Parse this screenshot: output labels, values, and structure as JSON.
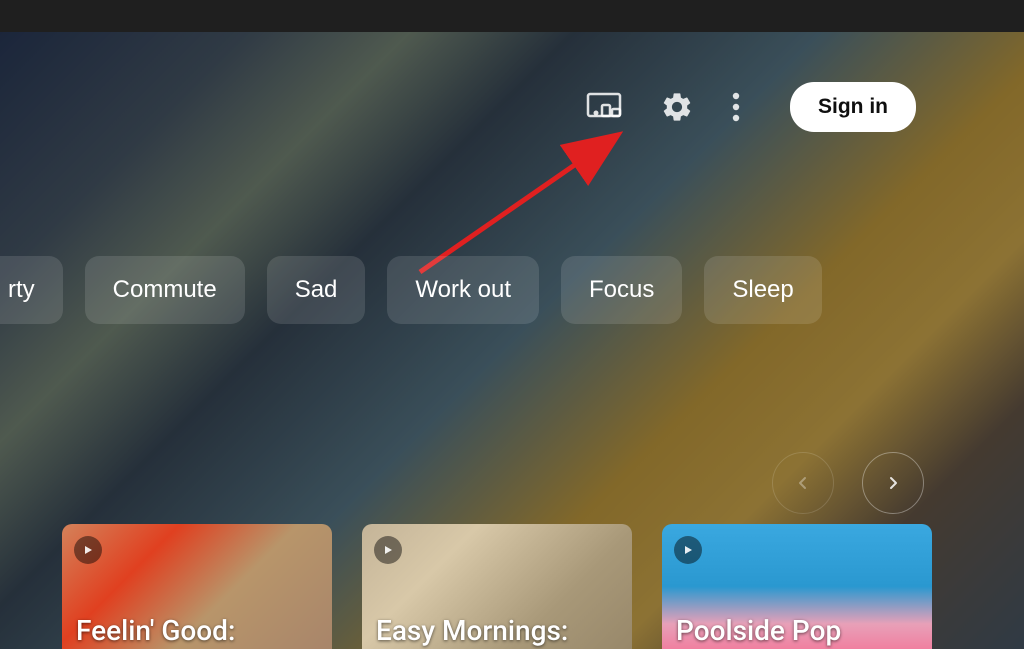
{
  "header": {
    "sign_in_label": "Sign in"
  },
  "chips": {
    "partial": "rty",
    "items": [
      "Commute",
      "Sad",
      "Work out",
      "Focus",
      "Sleep"
    ]
  },
  "cards": [
    {
      "title": "Feelin' Good:"
    },
    {
      "title": "Easy Mornings:"
    },
    {
      "title": "Poolside Pop"
    }
  ]
}
